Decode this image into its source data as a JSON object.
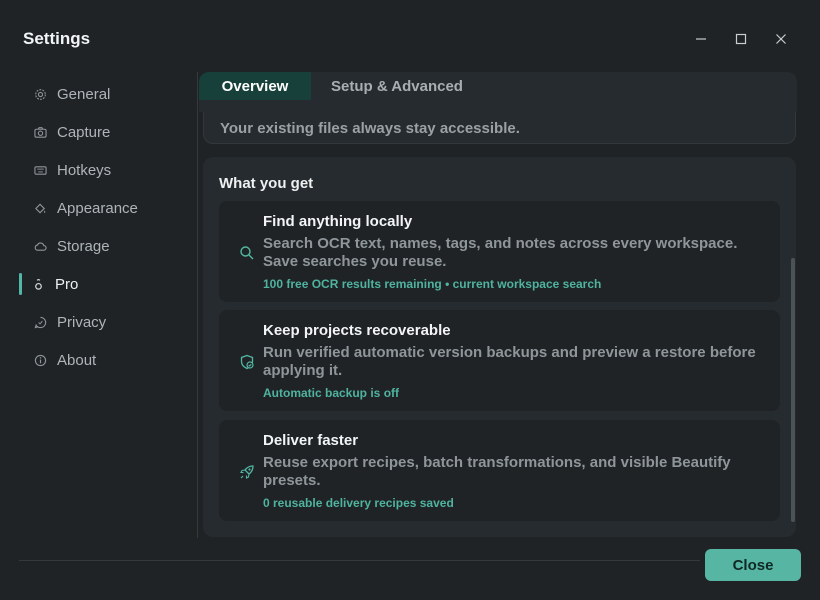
{
  "window": {
    "title": "Settings"
  },
  "sidebar": {
    "items": [
      {
        "label": "General",
        "icon": "gear-icon"
      },
      {
        "label": "Capture",
        "icon": "camera-icon"
      },
      {
        "label": "Hotkeys",
        "icon": "keyboard-icon"
      },
      {
        "label": "Appearance",
        "icon": "paint-bucket-icon"
      },
      {
        "label": "Storage",
        "icon": "cloud-icon"
      },
      {
        "label": "Pro",
        "icon": "pro-icon",
        "active": true
      },
      {
        "label": "Privacy",
        "icon": "shield-chat-icon"
      },
      {
        "label": "About",
        "icon": "info-icon"
      }
    ]
  },
  "tabs": [
    {
      "label": "Overview",
      "active": true
    },
    {
      "label": "Setup & Advanced",
      "active": false
    }
  ],
  "top_card": {
    "text": "Your existing files always stay accessible."
  },
  "section": {
    "title": "What you get",
    "features": [
      {
        "title": "Find anything locally",
        "description": "Search OCR text, names, tags, and notes across every workspace. Save searches you reuse.",
        "status": "100 free OCR results remaining • current workspace search",
        "icon": "search-icon"
      },
      {
        "title": "Keep projects recoverable",
        "description": "Run verified automatic version backups and preview a restore before applying it.",
        "status": "Automatic backup is off",
        "icon": "shield-check-icon"
      },
      {
        "title": "Deliver faster",
        "description": "Reuse export recipes, batch transformations, and visible Beautify presets.",
        "status": "0 reusable delivery recipes saved",
        "icon": "rocket-icon"
      }
    ]
  },
  "footer": {
    "close_label": "Close"
  },
  "colors": {
    "accent": "#52b7a3",
    "background": "#1f2326",
    "panel": "#262b2f",
    "active_tab": "#17403a"
  }
}
